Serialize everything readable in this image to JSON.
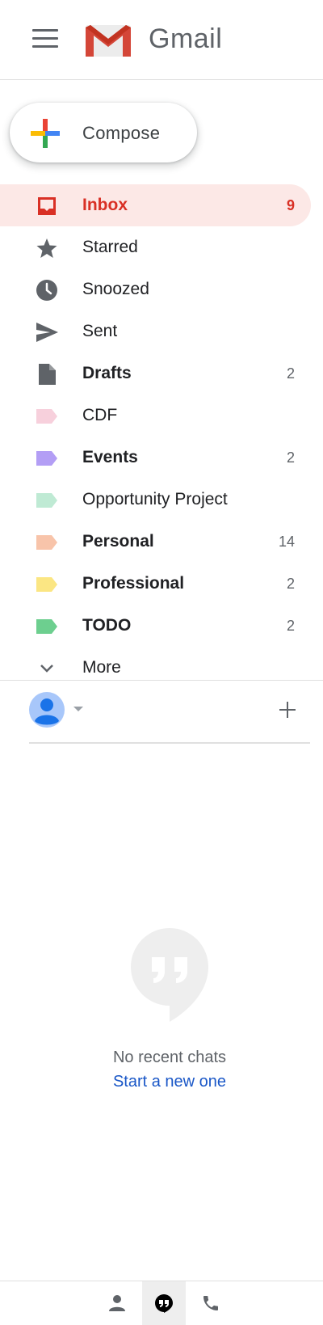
{
  "app": {
    "brand": "Gmail"
  },
  "compose": {
    "label": "Compose"
  },
  "colors": {
    "accent": "#d93025",
    "active_bg": "#fce8e6",
    "link": "#1a57c7"
  },
  "nav": {
    "items": [
      {
        "label": "Inbox",
        "count": "9",
        "icon": "inbox-icon",
        "active": true
      },
      {
        "label": "Starred",
        "count": "",
        "icon": "star-icon"
      },
      {
        "label": "Snoozed",
        "count": "",
        "icon": "clock-icon"
      },
      {
        "label": "Sent",
        "count": "",
        "icon": "send-icon"
      },
      {
        "label": "Drafts",
        "count": "2",
        "icon": "draft-icon"
      },
      {
        "label": "CDF",
        "count": "",
        "icon": "label-icon",
        "color": "#f7d0dc"
      },
      {
        "label": "Events",
        "count": "2",
        "icon": "label-icon",
        "color": "#b39ef5"
      },
      {
        "label": "Opportunity Project",
        "count": "",
        "icon": "label-icon",
        "color": "#bfead4"
      },
      {
        "label": "Personal",
        "count": "14",
        "icon": "label-icon",
        "color": "#f8c4aa"
      },
      {
        "label": "Professional",
        "count": "2",
        "icon": "label-icon",
        "color": "#fbe683"
      },
      {
        "label": "TODO",
        "count": "2",
        "icon": "label-icon",
        "color": "#6dcf8f"
      },
      {
        "label": "More",
        "count": "",
        "icon": "chevron-down-icon"
      }
    ]
  },
  "chat": {
    "empty_text": "No recent chats",
    "start_link": "Start a new one"
  }
}
